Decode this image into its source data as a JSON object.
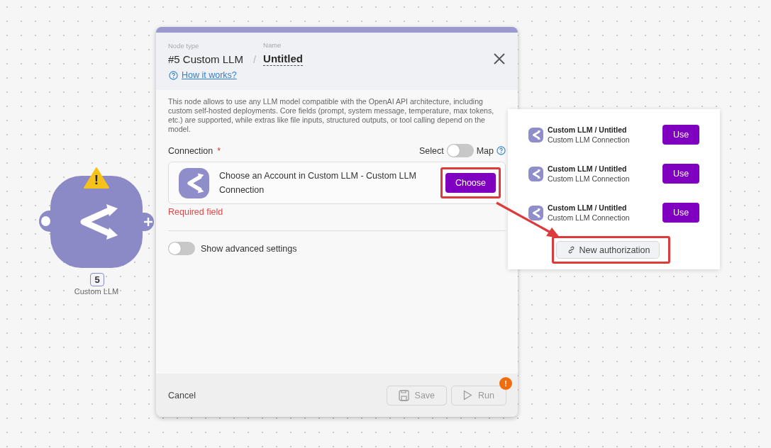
{
  "canvas": {
    "node": {
      "number": "5",
      "label": "Custom LLM",
      "warning": "!"
    }
  },
  "panel": {
    "node_type_label": "Node type",
    "node_type": "#5 Custom LLM",
    "separator": "/",
    "name_label": "Name",
    "name": "Untitled",
    "help_link": "How it works?",
    "description": "This node allows to use any LLM model compatible with the OpenAI API architecture, including custom self-hosted deployments. Core fields (prompt, system message, temperature, max tokens, etc.) are supported, while extras like file inputs, structured outputs, or tool calling depend on the model.",
    "connection": {
      "label": "Connection",
      "required_mark": "*",
      "mode_left": "Select",
      "mode_right": "Map",
      "map_mode": {
        "on": false
      },
      "placeholder": "Choose an Account in Custom LLM - Custom LLM Connection",
      "choose_button": {
        "label": "Choose",
        "highlighted": true
      },
      "error": "Required field"
    },
    "advanced": {
      "label": "Show advanced settings",
      "on": false
    },
    "footer": {
      "cancel": "Cancel",
      "save": {
        "label": "Save",
        "disabled": true
      },
      "run": {
        "label": "Run",
        "disabled": true,
        "badge": "!"
      }
    }
  },
  "account_menu": {
    "items": [
      {
        "title": "Custom LLM / Untitled",
        "subtitle": "Custom LLM Connection",
        "action": "Use"
      },
      {
        "title": "Custom LLM / Untitled",
        "subtitle": "Custom LLM Connection",
        "action": "Use"
      },
      {
        "title": "Custom LLM / Untitled",
        "subtitle": "Custom LLM Connection",
        "action": "Use"
      }
    ],
    "new_button": {
      "label": "New authorization",
      "highlighted": true
    }
  },
  "annotation_arrow": true
}
